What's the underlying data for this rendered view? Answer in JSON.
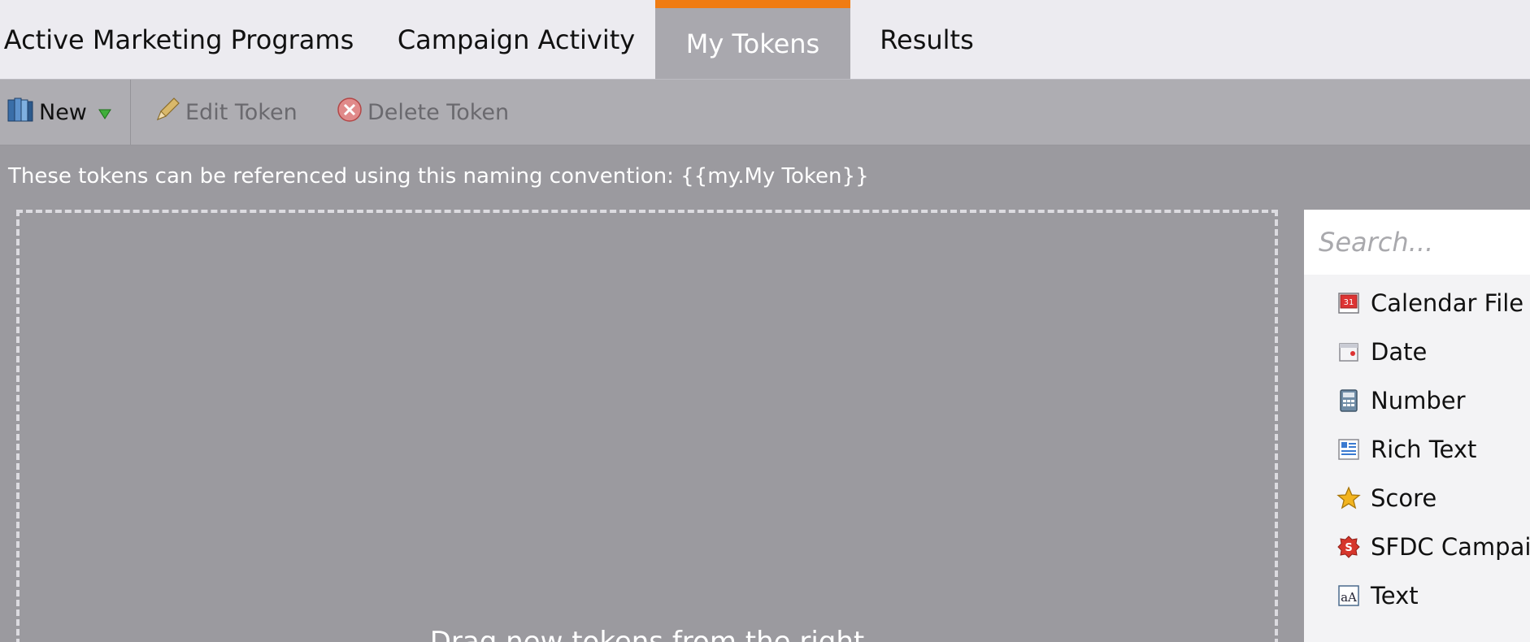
{
  "tabs": {
    "items": [
      {
        "label": "Active Marketing Programs"
      },
      {
        "label": "Campaign Activity"
      },
      {
        "label": "My Tokens"
      },
      {
        "label": "Results"
      }
    ],
    "active": "My Tokens",
    "accent_color": "#f07c12"
  },
  "toolbar": {
    "new_label": "New",
    "new_icon": "book-icon",
    "dropdown_icon": "green-triangle-down-icon",
    "edit_label": "Edit Token",
    "edit_icon": "pencil-icon",
    "delete_label": "Delete Token",
    "delete_icon": "red-x-circle-icon"
  },
  "info_text": "These tokens can be referenced using this naming convention: {{my.My Token}}",
  "dropzone": {
    "text": "Drag new tokens from the right"
  },
  "token_panel": {
    "search_placeholder": "Search...",
    "items": [
      {
        "label": "Calendar File",
        "icon": "calendar-file-icon"
      },
      {
        "label": "Date",
        "icon": "date-icon"
      },
      {
        "label": "Number",
        "icon": "calculator-icon"
      },
      {
        "label": "Rich Text",
        "icon": "rich-text-icon"
      },
      {
        "label": "Score",
        "icon": "star-icon"
      },
      {
        "label": "SFDC Campaign",
        "icon": "sfdc-icon"
      },
      {
        "label": "Text",
        "icon": "text-icon"
      }
    ]
  }
}
